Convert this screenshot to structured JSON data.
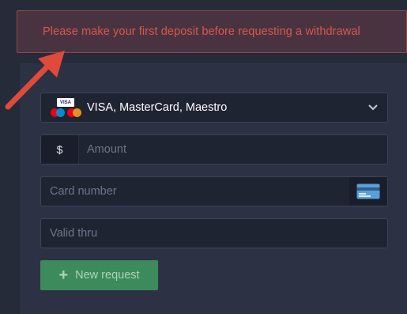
{
  "alert": {
    "message": "Please make your first deposit before requesting a withdrawal"
  },
  "payment_method": {
    "selected": "VISA, MasterCard, Maestro",
    "logo_text": "VISA",
    "icons": [
      "visa-logo",
      "mastercard-logo",
      "maestro-logo",
      "chevron-down-icon"
    ]
  },
  "amount": {
    "currency_symbol": "$",
    "placeholder": "Amount"
  },
  "card_number": {
    "placeholder": "Card number",
    "icon": "credit-card-icon"
  },
  "valid_thru": {
    "placeholder": "Valid thru"
  },
  "submit": {
    "icon": "plus-icon",
    "label": "New request"
  },
  "colors": {
    "alert_text": "#d9574e",
    "alert_border": "#8a4a4b",
    "button_bg": "#3d8a5c",
    "arrow": "#e04a3a"
  }
}
